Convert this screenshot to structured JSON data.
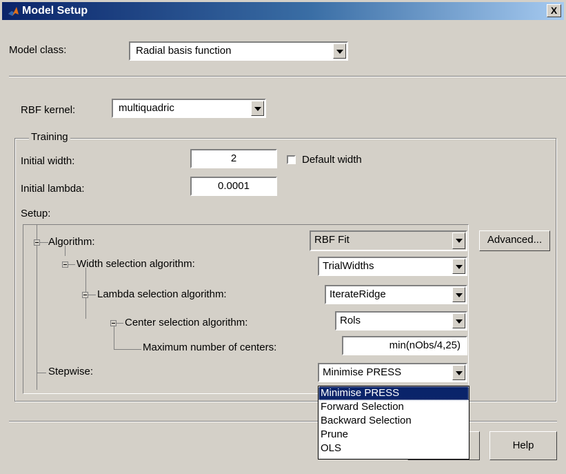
{
  "window": {
    "title": "Model Setup",
    "close_label": "X"
  },
  "model_class": {
    "label": "Model class:",
    "value": "Radial basis function"
  },
  "rbf_kernel": {
    "label": "RBF kernel:",
    "value": "multiquadric"
  },
  "training": {
    "legend": "Training",
    "initial_width": {
      "label": "Initial width:",
      "value": "2"
    },
    "default_width": {
      "label": "Default width",
      "checked": false
    },
    "initial_lambda": {
      "label": "Initial lambda:",
      "value": "0.0001"
    },
    "setup_label": "Setup:"
  },
  "setup_tree": [
    {
      "id": "algorithm",
      "label": "Algorithm:",
      "value": "RBF Fit"
    },
    {
      "id": "width",
      "label": "Width selection algorithm:",
      "value": "TrialWidths"
    },
    {
      "id": "lambda",
      "label": "Lambda selection algorithm:",
      "value": "IterateRidge"
    },
    {
      "id": "center",
      "label": "Center selection algorithm:",
      "value": "Rols"
    },
    {
      "id": "maxcenters",
      "label": "Maximum number of centers:",
      "value": "min(nObs/4,25)"
    },
    {
      "id": "stepwise",
      "label": "Stepwise:",
      "value": "Minimise PRESS"
    }
  ],
  "advanced_button": "Advanced...",
  "stepwise_options": [
    "Minimise PRESS",
    "Forward Selection",
    "Backward Selection",
    "Prune",
    "OLS"
  ],
  "stepwise_selected_index": 0,
  "help_button": "Help",
  "colors": {
    "dialog_bg": "#d4d0c8",
    "title_bar": "#0a246a",
    "selection": "#0a246a"
  }
}
